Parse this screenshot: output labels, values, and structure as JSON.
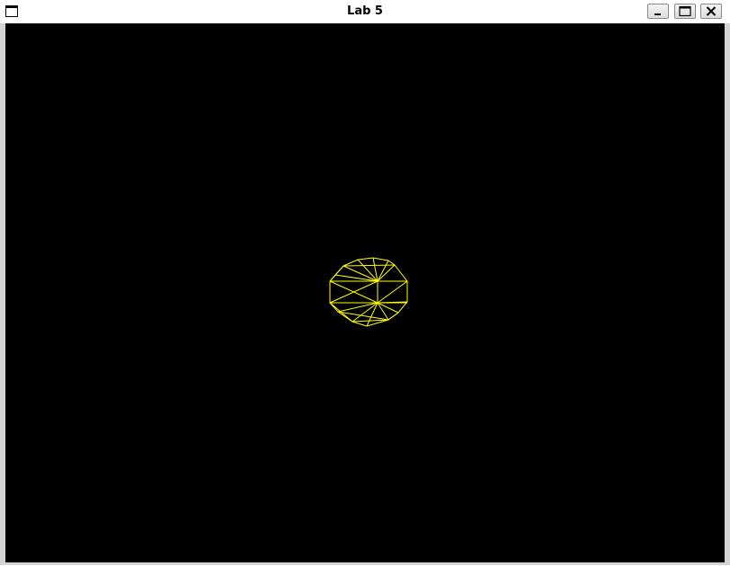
{
  "window": {
    "title": "Lab 5",
    "system_icon": "window-menu-icon",
    "controls": {
      "minimize_icon": "minimize-icon",
      "maximize_icon": "maximize-icon",
      "close_icon": "close-icon"
    }
  },
  "canvas": {
    "background": "#000000",
    "wireframe_color": "#ffff00",
    "object": "wireframe-sphere"
  }
}
